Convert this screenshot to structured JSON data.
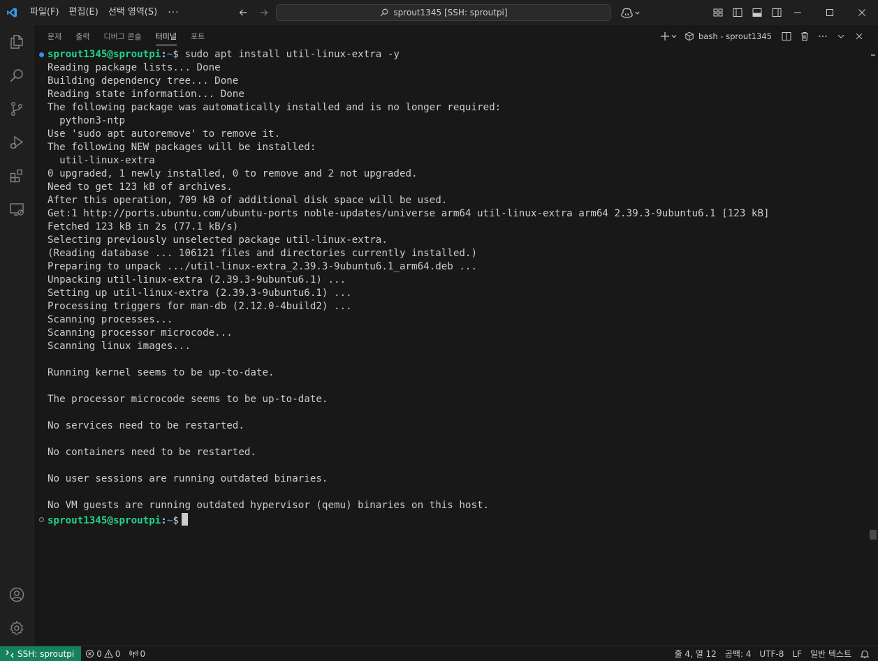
{
  "title_bar": {
    "menus": [
      "파일(F)",
      "편집(E)",
      "선택 영역(S)"
    ],
    "more": "···",
    "command_center": "sprout1345 [SSH: sproutpi]"
  },
  "panel": {
    "tabs": [
      "문제",
      "출력",
      "디버그 콘솔",
      "터미널",
      "포트"
    ],
    "active_tab": "터미널",
    "terminal_name": "bash - sprout1345"
  },
  "terminal": {
    "prompt": {
      "user_host": "sprout1345@sproutpi",
      "separator": ":",
      "path": "~",
      "symbol": "$"
    },
    "command": " sudo apt install util-linux-extra -y",
    "output": [
      "Reading package lists... Done",
      "Building dependency tree... Done",
      "Reading state information... Done",
      "The following package was automatically installed and is no longer required:",
      "  python3-ntp",
      "Use 'sudo apt autoremove' to remove it.",
      "The following NEW packages will be installed:",
      "  util-linux-extra",
      "0 upgraded, 1 newly installed, 0 to remove and 2 not upgraded.",
      "Need to get 123 kB of archives.",
      "After this operation, 709 kB of additional disk space will be used.",
      "Get:1 http://ports.ubuntu.com/ubuntu-ports noble-updates/universe arm64 util-linux-extra arm64 2.39.3-9ubuntu6.1 [123 kB]",
      "Fetched 123 kB in 2s (77.1 kB/s)",
      "Selecting previously unselected package util-linux-extra.",
      "(Reading database ... 106121 files and directories currently installed.)",
      "Preparing to unpack .../util-linux-extra_2.39.3-9ubuntu6.1_arm64.deb ...",
      "Unpacking util-linux-extra (2.39.3-9ubuntu6.1) ...",
      "Setting up util-linux-extra (2.39.3-9ubuntu6.1) ...",
      "Processing triggers for man-db (2.12.0-4build2) ...",
      "Scanning processes...",
      "Scanning processor microcode...",
      "Scanning linux images...",
      "",
      "Running kernel seems to be up-to-date.",
      "",
      "The processor microcode seems to be up-to-date.",
      "",
      "No services need to be restarted.",
      "",
      "No containers need to be restarted.",
      "",
      "No user sessions are running outdated binaries.",
      "",
      "No VM guests are running outdated hypervisor (qemu) binaries on this host."
    ]
  },
  "status_bar": {
    "remote": "SSH: sproutpi",
    "errors": "0",
    "warnings": "0",
    "ports": "0",
    "position": "줄 4, 열 12",
    "spaces": "공백: 4",
    "encoding": "UTF-8",
    "eol": "LF",
    "language": "일반 텍스트"
  },
  "colors": {
    "accent": "#0078d4",
    "remote_bg": "#16825d",
    "prompt_user": "#23d18b",
    "prompt_path": "#3b8eea"
  },
  "icons": {
    "activity_bar": [
      "explorer-icon",
      "search-icon",
      "source-control-icon",
      "run-debug-icon",
      "extensions-icon",
      "remote-explorer-icon",
      "account-icon",
      "settings-gear-icon"
    ]
  }
}
